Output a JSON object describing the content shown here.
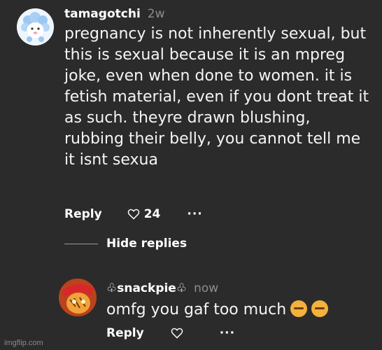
{
  "comment": {
    "username": "tamagotchi",
    "timestamp": "2w",
    "text": "pregnancy is not inherently sexual, but this is sexual because it is an mpreg joke, even when done to women. it is fetish material, even if you dont treat it as such. theyre drawn blushing, rubbing their belly, you cannot tell me it isnt sexua",
    "reply_label": "Reply",
    "like_count": "24",
    "avatar_icon": "sheep-avatar",
    "more_icon": "ellipsis-icon",
    "like_icon": "heart-outline-icon"
  },
  "replies_toggle": {
    "label": "Hide replies"
  },
  "reply": {
    "username": "♧snackpie♧",
    "timestamp": "now",
    "text": "omfg you gaf too much",
    "reply_label": "Reply",
    "avatar_icon": "cartoon-avatar",
    "emoji_icons": [
      "facepalm-emoji",
      "facepalm-emoji"
    ]
  },
  "watermark": "imgflip.com",
  "colors": {
    "background": "#2b2b2b",
    "text": "#ffffff",
    "muted": "#8d8d8d"
  }
}
